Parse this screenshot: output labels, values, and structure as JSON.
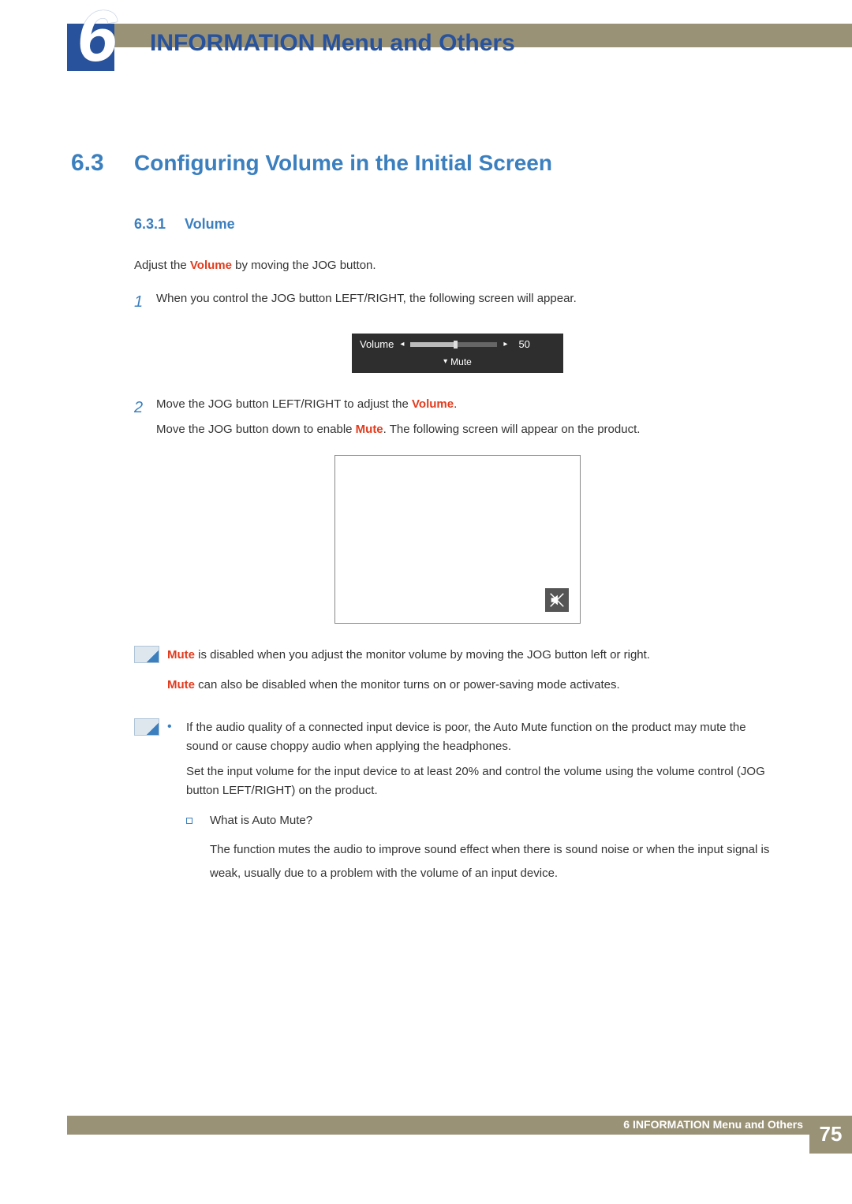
{
  "header": {
    "chapter_num": "6",
    "title": "INFORMATION Menu and Others"
  },
  "section": {
    "num": "6.3",
    "title": "Configuring Volume in the Initial Screen"
  },
  "subsection": {
    "num": "6.3.1",
    "title": "Volume"
  },
  "intro": {
    "pre": "Adjust the ",
    "vol": "Volume",
    "post": " by moving the JOG button."
  },
  "steps": [
    {
      "num": "1",
      "text": "When you control the JOG button LEFT/RIGHT, the following screen will appear."
    },
    {
      "num": "2",
      "line1_pre": "Move the JOG button LEFT/RIGHT to adjust the ",
      "line1_vol": "Volume",
      "line1_post": ".",
      "line2_pre": "Move the JOG button down to enable ",
      "line2_mute": "Mute",
      "line2_post": ". The following screen will appear on the product."
    }
  ],
  "osd": {
    "label": "Volume",
    "value": "50",
    "mute": "Mute"
  },
  "note1": {
    "l1_mute": "Mute",
    "l1_rest": " is disabled when you adjust the monitor volume by moving the JOG button left or right.",
    "l2_mute": "Mute",
    "l2_rest": " can also be disabled when the monitor turns on or power-saving mode activates."
  },
  "note2": {
    "b1a": "If the audio quality of a connected input device is poor, the Auto Mute function on the product may mute the sound or cause choppy audio when applying the headphones.",
    "b1b": "Set the input volume for the input device to at least 20% and control the volume using the volume control (JOG button LEFT/RIGHT) on the product.",
    "sub_q": "What is Auto Mute?",
    "sub_a": "The function mutes the audio to improve sound effect when there is sound noise or when the input signal is weak, usually due to a problem with the volume of an input device."
  },
  "footer": {
    "chapter": "6",
    "title": "INFORMATION Menu and Others",
    "page": "75"
  }
}
